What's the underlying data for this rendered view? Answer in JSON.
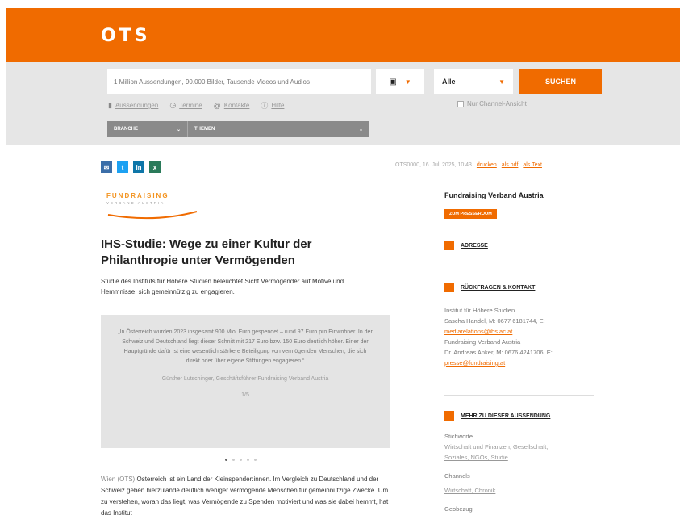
{
  "header": {
    "logo": "OTS"
  },
  "search": {
    "placeholder": "1 Million Aussendungen, 90.000 Bilder, Tausende Videos und Audios",
    "date_icon": "calendar-icon",
    "select_value": "Alle",
    "button": "SUCHEN",
    "links": [
      {
        "icon": "chart-icon",
        "label": "Aussendungen"
      },
      {
        "icon": "clock-icon",
        "label": "Termine"
      },
      {
        "icon": "at-icon",
        "label": "Kontakte"
      },
      {
        "icon": "info-icon",
        "label": "Hilfe"
      }
    ],
    "checkbox_label": "Nur Channel-Ansicht"
  },
  "filters": {
    "f1": "BRANCHE",
    "f2": "THEMEN"
  },
  "article": {
    "meta_date": "OTS0000, 16. Juli 2025, 10:43",
    "meta_links": [
      "drucken",
      "als pdf",
      "als Text"
    ],
    "brand_line1": "FUNDRAISING",
    "brand_line2": "VERBAND AUSTRIA",
    "title": "IHS-Studie: Wege zu einer Kultur der Philanthropie unter Vermögenden",
    "lead": "Studie des Instituts für Höhere Studien beleuchtet Sicht Vermögender auf Motive und Hemmnisse, sich gemeinnützig zu engagieren.",
    "quote": "„In Österreich wurden 2023 insgesamt 900 Mio. Euro gespendet – rund 97 Euro pro Einwohner. In der Schweiz und Deutschland liegt dieser Schnitt mit 217 Euro bzw. 150 Euro deutlich höher. Einer der Hauptgründe dafür ist eine wesentlich stärkere Beteiligung von vermögenden Menschen, die sich direkt oder über eigene Stiftungen engagieren.“",
    "quote_author": "Günther Lutschinger, Geschäftsführer Fundraising Verband Austria",
    "quote_more": "1/5",
    "body_loc": "Wien (OTS)",
    "body": "Österreich ist ein Land der Kleinspender:innen. Im Vergleich zu Deutschland und der Schweiz geben hierzulande deutlich weniger vermögende Menschen für gemeinnützige Zwecke. Um zu verstehen, woran das liegt, was Vermögende zu Spenden motiviert und was sie dabei hemmt, hat das Institut"
  },
  "sidebar": {
    "org": "Fundraising Verband Austria",
    "press_button": "ZUM PRESSEROOM",
    "section_address": "ADRESSE",
    "section_contact": "RÜCKFRAGEN & KONTAKT",
    "contact_lines": [
      "Institut für Höhere Studien",
      "Sascha Handel, M: 0677 6181744, E:"
    ],
    "contact_mail1": "mediarelations@ihs.ac.at",
    "contact_lines2": [
      "Fundraising Verband Austria",
      "Dr. Andreas Anker, M: 0676 4241706, E:"
    ],
    "contact_mail2": "presse@fundraising.at",
    "section_more": "MEHR ZU DIESER AUSSENDUNG",
    "tags_label": "Stichworte",
    "tags_1": "Wirtschaft und Finanzen, Gesellschaft,",
    "tags_2": "Soziales, NGOs, Studie",
    "channels_label": "Channels",
    "channels": "Wirtschaft, Chronik",
    "region_label": "Geobezug"
  }
}
